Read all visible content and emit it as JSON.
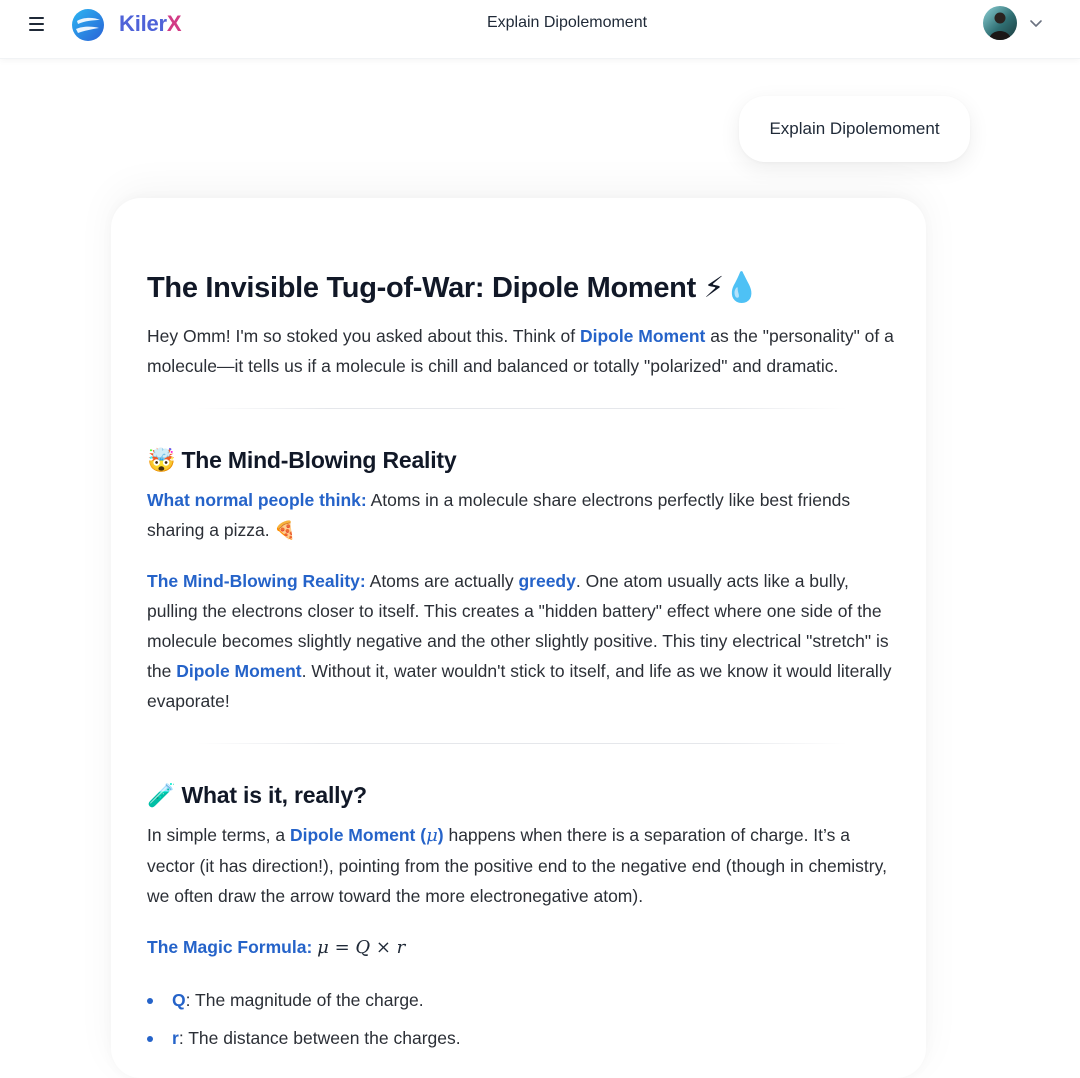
{
  "header": {
    "brand_part1": "Kiler",
    "brand_part2": "X",
    "title": "Explain Dipolemoment",
    "menu_icon": "hamburger-icon",
    "dropdown_icon": "chevron-down-icon"
  },
  "user_message": "Explain Dipolemoment",
  "response": {
    "title": "The Invisible Tug-of-War: Dipole Moment ⚡💧",
    "intro": {
      "before": "Hey Omm! I'm so stoked you asked about this. Think of ",
      "highlight": "Dipole Moment",
      "after": " as the \"personality\" of a molecule—it tells us if a molecule is chill and balanced or totally \"polarized\" and dramatic."
    },
    "section1": {
      "emoji": "🤯",
      "heading": "The Mind-Blowing Reality",
      "p1_label": "What normal people think:",
      "p1_text": " Atoms in a molecule share electrons perfectly like best friends sharing a pizza. 🍕",
      "p2_label": "The Mind-Blowing Reality:",
      "p2_text1": " Atoms are actually ",
      "p2_hl1": "greedy",
      "p2_text2": ". One atom usually acts like a bully, pulling the electrons closer to itself. This creates a \"hidden battery\" effect where one side of the molecule becomes slightly negative and the other slightly positive. This tiny electrical \"stretch\" is the ",
      "p2_hl2": "Dipole Moment",
      "p2_text3": ". Without it, water wouldn't stick to itself, and life as we know it would literally evaporate!"
    },
    "section2": {
      "emoji": "🧪",
      "heading": "What is it, really?",
      "p1_text1": "In simple terms, a ",
      "p1_hl": "Dipole Moment (",
      "p1_mu": "μ",
      "p1_hl_close": ")",
      "p1_text2": " happens when there is a separation of charge. It’s a vector (it has direction!), pointing from the positive end to the negative end (though in chemistry, we often draw the arrow toward the more electronegative atom).",
      "formula_label": "The Magic Formula:",
      "formula": "μ = Q × r",
      "bullets": [
        {
          "term": "Q",
          "desc": ": The magnitude of the charge."
        },
        {
          "term": "r",
          "desc": ": The distance between the charges."
        }
      ]
    }
  },
  "colors": {
    "accent": "#2563c9",
    "brand_blue": "#4f63d8",
    "brand_pink": "#d23b86"
  }
}
